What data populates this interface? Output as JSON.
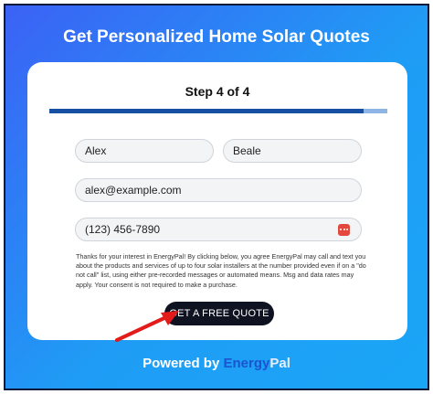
{
  "header": {
    "title": "Get Personalized Home Solar Quotes"
  },
  "form": {
    "step_label": "Step 4 of 4",
    "progress": 0.93,
    "first_name": "Alex",
    "last_name": "Beale",
    "email": "alex@example.com",
    "phone": "(123) 456-7890",
    "consent": "Thanks for your interest in EnergyPal! By clicking below, you agree EnergyPal may call and text you about the products and services of up to four solar installers at the number provided even if on a \"do not call\" list, using either pre-recorded messages or automated means. Msg and data rates may apply. Your consent is not required to make a purchase.",
    "submit_label": "GET A FREE QUOTE"
  },
  "footer": {
    "powered_prefix": "Powered by",
    "brand_part1": "Energy",
    "brand_part2": "Pal"
  },
  "colors": {
    "arrow": "#e31b1b",
    "progress_fill": "#174fa3",
    "progress_track": "#8fb4e6",
    "button": "#0f1220"
  }
}
